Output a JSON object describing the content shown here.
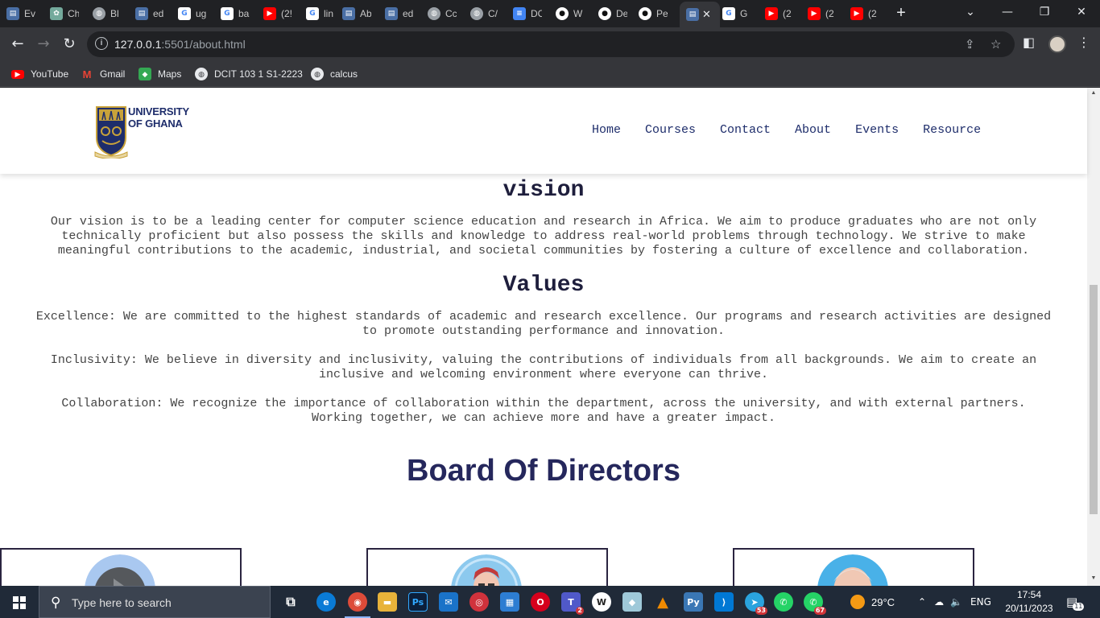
{
  "browser": {
    "tabs": [
      {
        "label": "Ev",
        "icon": "doc-icon",
        "color": "#4a6fa5"
      },
      {
        "label": "Ch",
        "icon": "chatgpt-icon",
        "color": "#74aa9c"
      },
      {
        "label": "Bl",
        "icon": "globe-icon",
        "color": "#5f6368"
      },
      {
        "label": "ed",
        "icon": "doc-icon",
        "color": "#4a6fa5"
      },
      {
        "label": "ug",
        "icon": "google-icon",
        "color": "#ffffff"
      },
      {
        "label": "ba",
        "icon": "google-icon",
        "color": "#ffffff"
      },
      {
        "label": "(2!",
        "icon": "youtube-icon",
        "color": "#ff0000"
      },
      {
        "label": "lin",
        "icon": "google-icon",
        "color": "#ffffff"
      },
      {
        "label": "Ab",
        "icon": "doc-icon",
        "color": "#4a6fa5"
      },
      {
        "label": "ed",
        "icon": "doc-icon",
        "color": "#4a6fa5"
      },
      {
        "label": "Cc",
        "icon": "globe-icon",
        "color": "#5f6368"
      },
      {
        "label": "C/",
        "icon": "globe-icon",
        "color": "#5f6368"
      },
      {
        "label": "DC",
        "icon": "gdocs-icon",
        "color": "#4285f4"
      },
      {
        "label": "W",
        "icon": "github-icon",
        "color": "#ffffff"
      },
      {
        "label": "De",
        "icon": "github-icon",
        "color": "#ffffff"
      },
      {
        "label": "Pe",
        "icon": "github-icon",
        "color": "#ffffff"
      },
      {
        "label": "",
        "icon": "doc-icon",
        "color": "#4a6fa5",
        "active": true
      },
      {
        "label": "G",
        "icon": "google-icon",
        "color": "#ffffff"
      },
      {
        "label": "(2",
        "icon": "youtube-icon",
        "color": "#ff0000"
      },
      {
        "label": "(2",
        "icon": "youtube-icon",
        "color": "#ff0000"
      },
      {
        "label": "(2",
        "icon": "youtube-icon",
        "color": "#ff0000"
      }
    ],
    "url_host": "127.0.0.1",
    "url_path": ":5501/about.html",
    "bookmarks": [
      {
        "label": "YouTube",
        "icon": "youtube-icon",
        "color": "#ff0000"
      },
      {
        "label": "Gmail",
        "icon": "gmail-icon",
        "color": "#ea4335"
      },
      {
        "label": "Maps",
        "icon": "maps-icon",
        "color": "#34a853"
      },
      {
        "label": "DCIT 103 1 S1-2223",
        "icon": "globe-icon",
        "color": "#e8eaed"
      },
      {
        "label": "calcus",
        "icon": "globe-icon",
        "color": "#e8eaed"
      }
    ]
  },
  "site": {
    "logo_line1": "UNIVERSITY",
    "logo_line2": "OF GHANA",
    "nav": [
      "Home",
      "Courses",
      "Contact",
      "About",
      "Events",
      "Resource"
    ],
    "vision_heading": "vision",
    "vision_lines": [
      "Our vision is to be a leading center for computer science education and research in Africa. We aim to produce graduates who are not only",
      "technically proficient but also possess the skills and knowledge to address real-world problems through technology. We strive to make",
      "meaningful contributions to the academic, industrial, and societal communities by fostering a culture of excellence and collaboration."
    ],
    "values_heading": "Values",
    "values": [
      [
        "Excellence: We are committed to the highest standards of academic and research excellence. Our programs and research activities are designed",
        "to promote outstanding performance and innovation."
      ],
      [
        "Inclusivity: We believe in diversity and inclusivity, valuing the contributions of individuals from all backgrounds. We aim to create an",
        "inclusive and welcoming environment where everyone can thrive."
      ],
      [
        "Collaboration: We recognize the importance of collaboration within the department, across the university, and with external partners.",
        "Working together, we can achieve more and have a greater impact."
      ]
    ],
    "board_heading": "Board Of Directors"
  },
  "taskbar": {
    "search_placeholder": "Type here to search",
    "weather": "29°C",
    "language": "ENG",
    "time": "17:54",
    "date": "20/11/2023",
    "notifications": "11",
    "telegram_badge": "53",
    "whatsapp_badge": "67",
    "teams_badge": "2"
  }
}
